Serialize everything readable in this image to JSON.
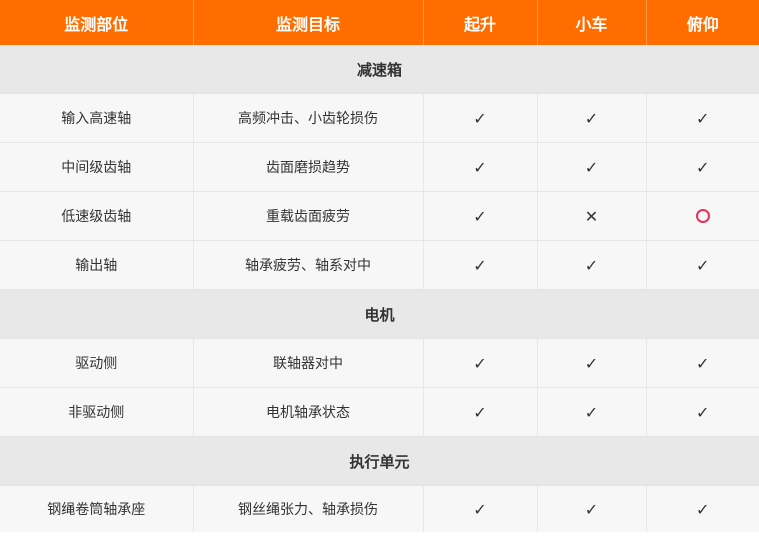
{
  "header": {
    "columns": [
      "监测部位",
      "监测目标",
      "起升",
      "小车",
      "俯仰"
    ]
  },
  "colors": {
    "header_bg": "#ff6d00",
    "section_bg": "#e8e8e8",
    "row_bg": "#f7f7f7",
    "circle_mark": "#e8305a"
  },
  "legend_symbols": {
    "check": "✓",
    "cross": "✕",
    "circle": "circle-icon"
  },
  "sections": [
    {
      "title": "减速箱",
      "rows": [
        {
          "part": "输入高速轴",
          "target": "高频冲击、小齿轮损伤",
          "marks": [
            "check",
            "check",
            "check"
          ]
        },
        {
          "part": "中间级齿轴",
          "target": "齿面磨损趋势",
          "marks": [
            "check",
            "check",
            "check"
          ]
        },
        {
          "part": "低速级齿轴",
          "target": "重载齿面疲劳",
          "marks": [
            "check",
            "cross",
            "circle"
          ]
        },
        {
          "part": "输出轴",
          "target": "轴承疲劳、轴系对中",
          "marks": [
            "check",
            "check",
            "check"
          ]
        }
      ]
    },
    {
      "title": "电机",
      "rows": [
        {
          "part": "驱动侧",
          "target": "联轴器对中",
          "marks": [
            "check",
            "check",
            "check"
          ]
        },
        {
          "part": "非驱动侧",
          "target": "电机轴承状态",
          "marks": [
            "check",
            "check",
            "check"
          ]
        }
      ]
    },
    {
      "title": "执行单元",
      "rows": [
        {
          "part": "钢绳卷筒轴承座",
          "target": "钢丝绳张力、轴承损伤",
          "marks": [
            "check",
            "check",
            "check"
          ]
        }
      ]
    }
  ]
}
